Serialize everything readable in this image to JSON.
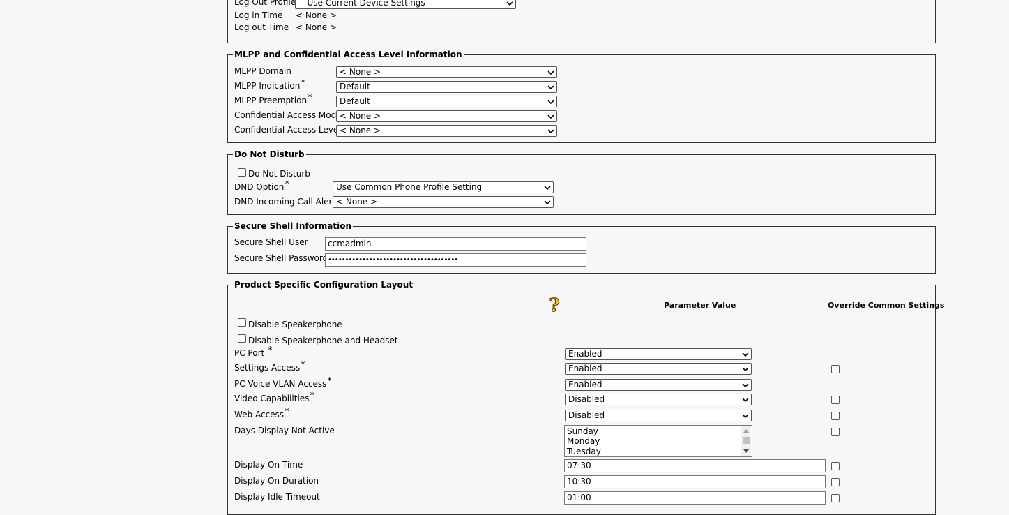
{
  "login_section": {
    "log_out_profile_label": "Log Out Profile",
    "log_out_profile_value": "-- Use Current Device Settings --",
    "log_in_time_label": "Log in Time",
    "log_in_time_value": "< None >",
    "log_out_time_label": "Log out Time",
    "log_out_time_value": "< None >"
  },
  "mlpp": {
    "legend": "MLPP and Confidential Access Level Information",
    "fields": [
      {
        "label": "MLPP Domain",
        "value": "< None >",
        "required": ""
      },
      {
        "label": "MLPP Indication",
        "value": "Default",
        "required": "*"
      },
      {
        "label": "MLPP Preemption",
        "value": "Default",
        "required": "*"
      },
      {
        "label": "Confidential Access Mode",
        "value": "< None >",
        "required": ""
      },
      {
        "label": "Confidential Access Level",
        "value": "< None >",
        "required": ""
      }
    ]
  },
  "dnd": {
    "legend": "Do Not Disturb",
    "checkbox_label": "Do Not Disturb",
    "checkbox_checked": false,
    "option_label": "DND Option",
    "option_required": "*",
    "option_value": "Use Common Phone Profile Setting",
    "alert_label": "DND Incoming Call Alert",
    "alert_value": "< None >"
  },
  "ssh": {
    "legend": "Secure Shell Information",
    "user_label": "Secure Shell User",
    "user_value": "ccmadmin",
    "password_label": "Secure Shell Password",
    "password_value": "••••••••••••••••••••••••••••••••••••••"
  },
  "product": {
    "legend": "Product Specific Configuration Layout",
    "help_icon_glyph": "?",
    "col_parameter_value": "Parameter Value",
    "col_override": "Override Common Settings",
    "disable_speakerphone_label": "Disable Speakerphone",
    "disable_speakerphone_headset_label": "Disable Speakerphone and Headset",
    "rows": [
      {
        "label": "PC Port",
        "required": "*",
        "value": "Enabled"
      },
      {
        "label": "Settings Access",
        "required": "*",
        "value": "Enabled"
      },
      {
        "label": "PC Voice VLAN Access",
        "required": "*",
        "value": "Enabled"
      },
      {
        "label": "Video Capabilities",
        "required": "*",
        "value": "Disabled"
      },
      {
        "label": "Web Access",
        "required": "*",
        "value": "Disabled"
      }
    ],
    "days_label": "Days Display Not Active",
    "days_options": [
      "Sunday",
      "Monday",
      "Tuesday"
    ],
    "display_on_time_label": "Display On Time",
    "display_on_time_value": "07:30",
    "display_on_duration_label": "Display On Duration",
    "display_on_duration_value": "10:30",
    "display_idle_timeout_label": "Display Idle Timeout",
    "display_idle_timeout_value": "01:00"
  }
}
